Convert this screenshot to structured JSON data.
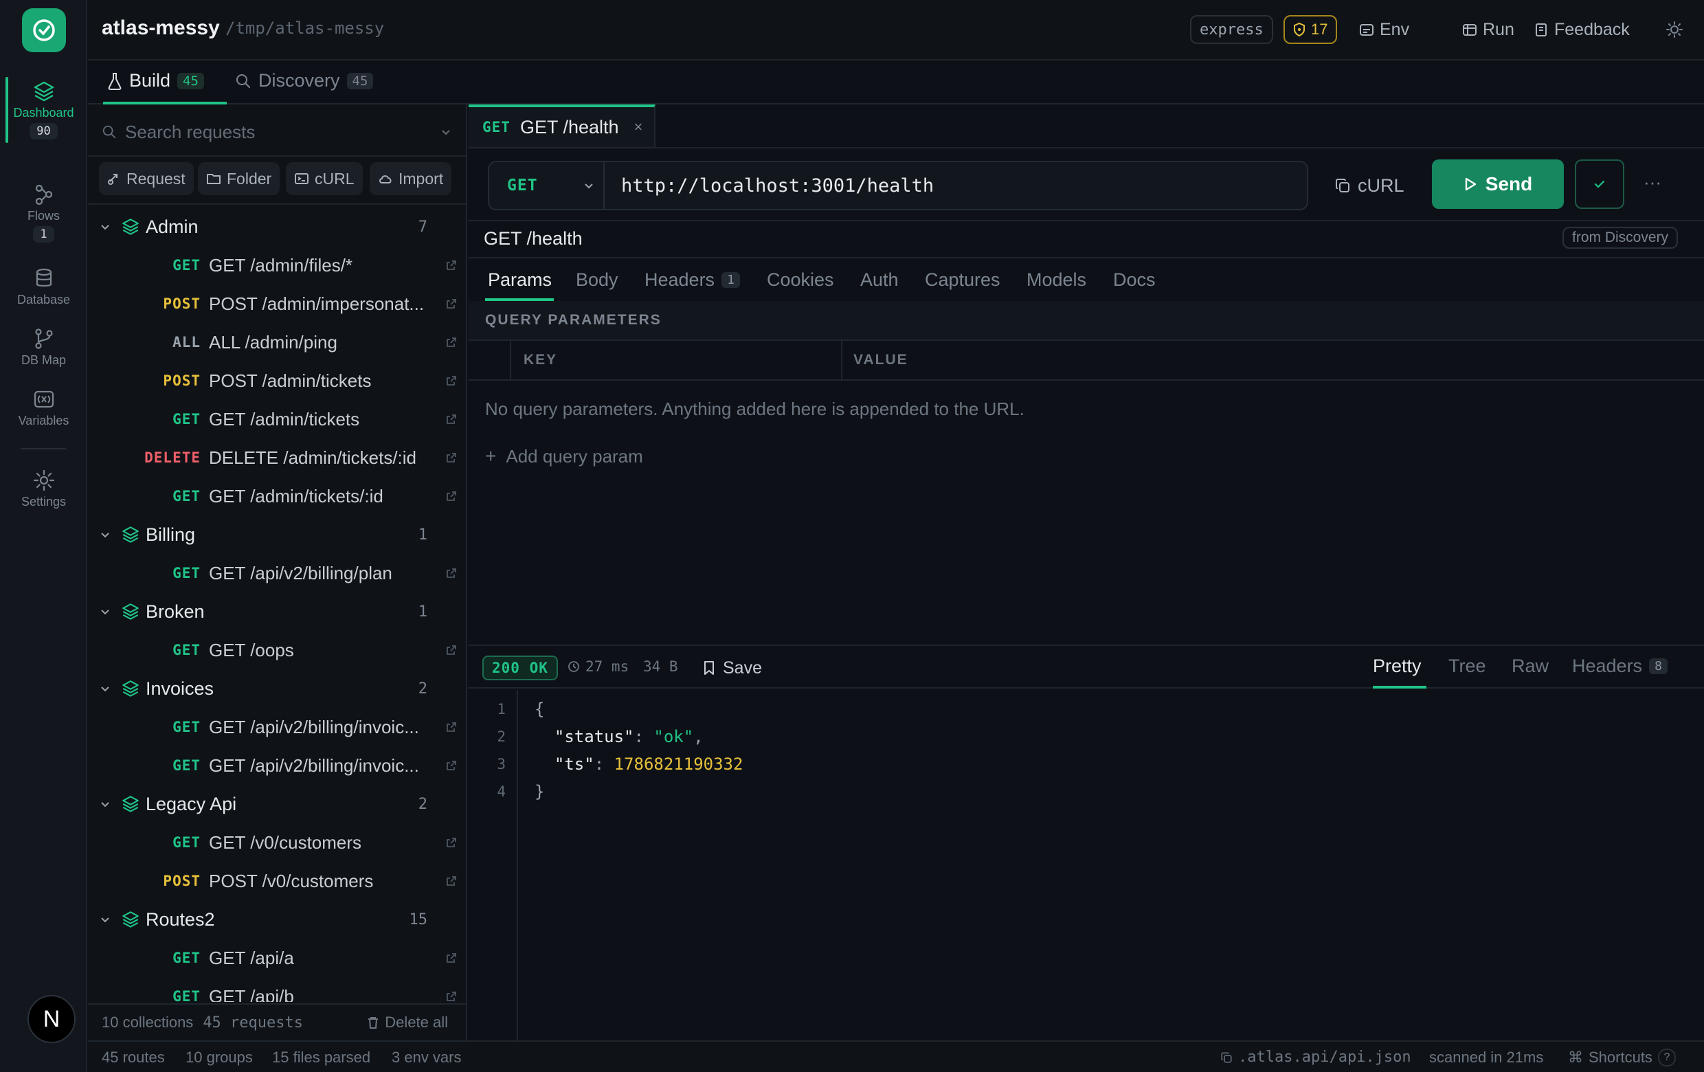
{
  "app": {
    "title": "atlas-messy",
    "path": "/tmp/atlas-messy",
    "framework_badge": "express",
    "warning_count": "17",
    "env_label": "Env",
    "run_label": "Run",
    "feedback_label": "Feedback"
  },
  "rail": {
    "items": [
      {
        "label": "Dashboard",
        "count": "90",
        "active": true,
        "icon": "layers-icon"
      },
      {
        "label": "Flows",
        "count": "1",
        "icon": "flows-icon"
      },
      {
        "label": "Database",
        "icon": "database-icon"
      },
      {
        "label": "DB Map",
        "icon": "db-map-icon"
      },
      {
        "label": "Variables",
        "icon": "variables-icon"
      },
      {
        "label": "Settings",
        "icon": "gear-icon"
      }
    ],
    "avatar": "N"
  },
  "build_tabs": [
    {
      "label": "Build",
      "count": "45",
      "active": true
    },
    {
      "label": "Discovery",
      "count": "45"
    }
  ],
  "sidebar": {
    "search_placeholder": "Search requests",
    "actions": [
      "Request",
      "Folder",
      "cURL",
      "Import"
    ],
    "groups": [
      {
        "name": "Admin",
        "count": "7",
        "requests": [
          {
            "method": "GET",
            "name": "GET /admin/files/*"
          },
          {
            "method": "POST",
            "name": "POST /admin/impersonat..."
          },
          {
            "method": "ALL",
            "name": "ALL /admin/ping"
          },
          {
            "method": "POST",
            "name": "POST /admin/tickets"
          },
          {
            "method": "GET",
            "name": "GET /admin/tickets"
          },
          {
            "method": "DELETE",
            "name": "DELETE /admin/tickets/:id"
          },
          {
            "method": "GET",
            "name": "GET /admin/tickets/:id"
          }
        ]
      },
      {
        "name": "Billing",
        "count": "1",
        "requests": [
          {
            "method": "GET",
            "name": "GET /api/v2/billing/plan"
          }
        ]
      },
      {
        "name": "Broken",
        "count": "1",
        "requests": [
          {
            "method": "GET",
            "name": "GET /oops"
          }
        ]
      },
      {
        "name": "Invoices",
        "count": "2",
        "requests": [
          {
            "method": "GET",
            "name": "GET /api/v2/billing/invoic..."
          },
          {
            "method": "GET",
            "name": "GET /api/v2/billing/invoic..."
          }
        ]
      },
      {
        "name": "Legacy Api",
        "count": "2",
        "requests": [
          {
            "method": "GET",
            "name": "GET /v0/customers"
          },
          {
            "method": "POST",
            "name": "POST /v0/customers"
          }
        ]
      },
      {
        "name": "Routes2",
        "count": "15",
        "requests": [
          {
            "method": "GET",
            "name": "GET /api/a"
          },
          {
            "method": "GET",
            "name": "GET /api/b"
          }
        ]
      }
    ],
    "footer": {
      "collections": "10 collections",
      "requests": "45 requests",
      "delete_all": "Delete all"
    }
  },
  "request": {
    "tab_method": "GET",
    "tab_name": "GET /health",
    "method": "GET",
    "url": "http://localhost:3001/health",
    "curl_label": "cURL",
    "send_label": "Send",
    "title": "GET /health",
    "source_badge": "from Discovery",
    "tabs": [
      {
        "label": "Params",
        "active": true
      },
      {
        "label": "Body"
      },
      {
        "label": "Headers",
        "count": "1"
      },
      {
        "label": "Cookies"
      },
      {
        "label": "Auth"
      },
      {
        "label": "Captures"
      },
      {
        "label": "Models"
      },
      {
        "label": "Docs"
      }
    ],
    "params": {
      "section_title": "QUERY PARAMETERS",
      "col_key": "KEY",
      "col_value": "VALUE",
      "empty_message": "No query parameters. Anything added here is appended to the URL.",
      "add_label": "Add query param"
    }
  },
  "response": {
    "status": "200 OK",
    "time": "27 ms",
    "size": "34 B",
    "save_label": "Save",
    "tabs": [
      {
        "label": "Pretty",
        "active": true
      },
      {
        "label": "Tree"
      },
      {
        "label": "Raw"
      },
      {
        "label": "Headers",
        "count": "8"
      }
    ],
    "body": {
      "line1": "{",
      "key_status": "\"status\"",
      "val_status": "\"ok\"",
      "key_ts": "\"ts\"",
      "val_ts": "1786821190332",
      "line4": "}"
    },
    "line_numbers": [
      "1",
      "2",
      "3",
      "4"
    ]
  },
  "statusbar": {
    "routes": "45 routes",
    "groups": "10 groups",
    "files": "15 files parsed",
    "env_vars": "3 env vars",
    "spec_file": ".atlas.api/api.json",
    "scan_time": "scanned in 21ms",
    "shortcuts": "Shortcuts",
    "help": "?"
  },
  "colors": {
    "accent": "#20c487",
    "post": "#e7c03a",
    "delete": "#f0606a",
    "background": "#0d1117"
  }
}
